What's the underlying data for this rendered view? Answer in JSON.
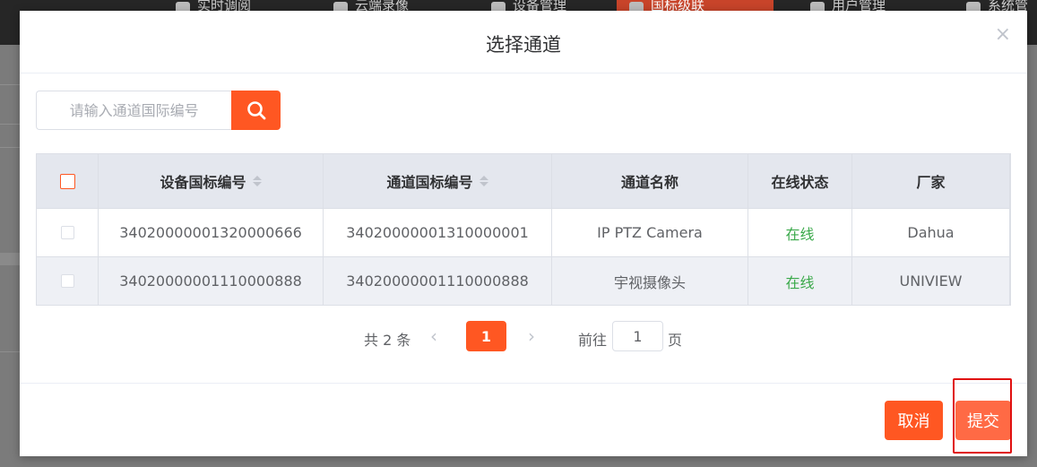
{
  "background": {
    "nav": [
      "实时调阅",
      "云端录像",
      "设备管理",
      "国标级联",
      "用户管理",
      "系统管"
    ]
  },
  "modal": {
    "title": "选择通道",
    "close_glyph": "×",
    "search": {
      "placeholder": "请输入通道国际编号",
      "value": ""
    },
    "table": {
      "columns": [
        "设备国标编号",
        "通道国标编号",
        "通道名称",
        "在线状态",
        "厂家"
      ],
      "rows": [
        {
          "device_id": "34020000001320000666",
          "channel_id": "34020000001310000001",
          "name": "IP PTZ Camera",
          "status": "在线",
          "vendor": "Dahua"
        },
        {
          "device_id": "34020000001110000888",
          "channel_id": "34020000001110000888",
          "name": "宇视摄像头",
          "status": "在线",
          "vendor": "UNIVIEW"
        }
      ]
    },
    "pagination": {
      "total": "共 2 条",
      "current": "1",
      "goto": "前往",
      "goto_value": "1",
      "page": "页"
    },
    "buttons": {
      "cancel": "取消",
      "submit": "提交"
    }
  },
  "colors": {
    "accent": "#ff5722",
    "online": "#3aa94a",
    "highlight": "#e01010"
  }
}
